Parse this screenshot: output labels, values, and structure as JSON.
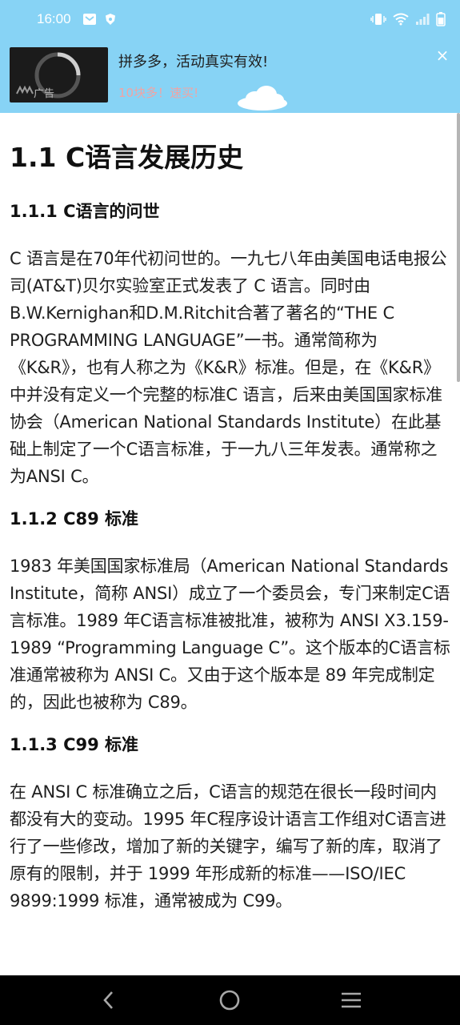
{
  "status_bar": {
    "time": "16:00",
    "icons": [
      "mail-icon",
      "shield-icon",
      "vibrate-icon",
      "wifi-icon",
      "signal-icon",
      "battery-icon"
    ]
  },
  "ad": {
    "tag": "广告",
    "title": "拼多多，活动真实有效!",
    "subtitle": "10块多！速买!",
    "close": "×",
    "colors": {
      "background": "#87d3f5",
      "subtitle": "#f0a4a4"
    }
  },
  "article": {
    "title": "1.1 C语言发展历史",
    "sections": [
      {
        "heading": "1.1.1 C语言的问世",
        "body": " C 语言是在70年代初问世的。一九七八年由美国电话电报公司(AT&T)贝尔实验室正式发表了 C 语言。同时由B.W.Kernighan和D.M.Ritchit合著了著名的“THE C PROGRAMMING LANGUAGE”一书。通常简称为《K&R》，也有人称之为《K&R》标准。但是，在《K&R》中并没有定义一个完整的标准C 语言，后来由美国国家标准协会（American National Standards Institute）在此基础上制定了一个C语言标准，于一九八三年发表。通常称之为ANSI C。"
      },
      {
        "heading": "1.1.2 C89 标准",
        "body": "1983 年美国国家标准局（American National Standards Institute，简称 ANSI）成立了一个委员会，专门来制定C语言标准。1989 年C语言标准被批准，被称为 ANSI X3.159-1989 “Programming Language C”。这个版本的C语言标准通常被称为 ANSI C。又由于这个版本是 89 年完成制定的，因此也被称为 C89。"
      },
      {
        "heading": "1.1.3 C99 标准",
        "body": "在 ANSI C 标准确立之后，C语言的规范在很长一段时间内都没有大的变动。1995 年C程序设计语言工作组对C语言进行了一些修改，增加了新的关键字，编写了新的库，取消了原有的限制，并于 1999 年形成新的标准——ISO/IEC 9899:1999 标准，通常被成为 C99。"
      }
    ]
  },
  "nav_bar": {
    "buttons": [
      "back-icon",
      "home-icon",
      "menu-icon"
    ]
  }
}
